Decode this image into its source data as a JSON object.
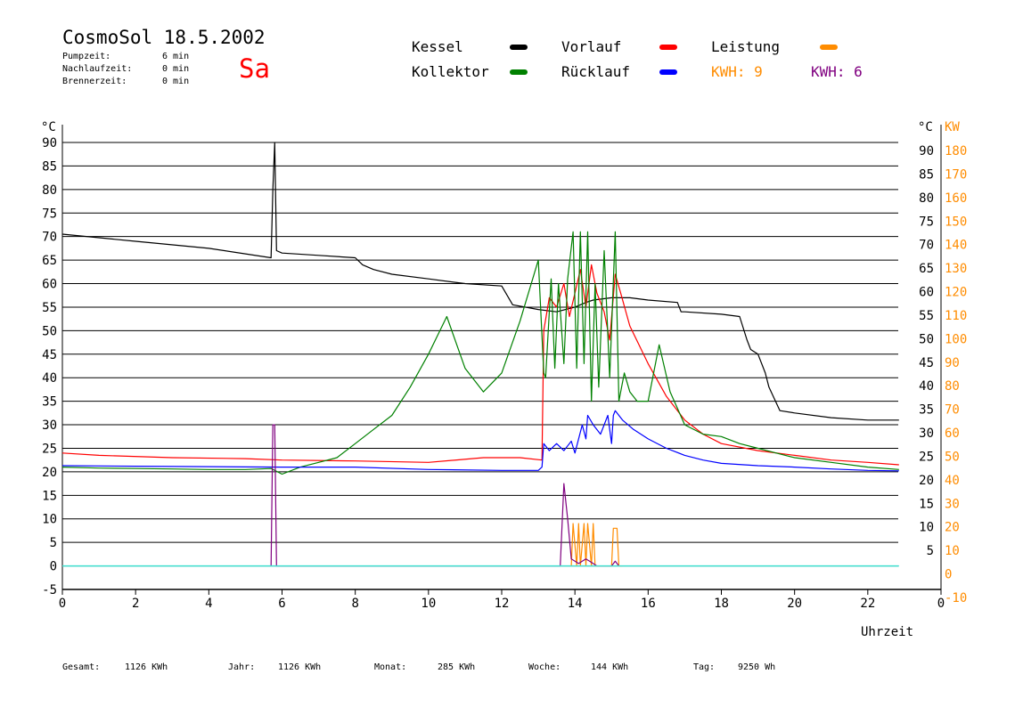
{
  "header": {
    "title": "CosmoSol 18.5.2002",
    "day": "Sa",
    "info": [
      {
        "label": "Pumpzeit:",
        "value": "6 min"
      },
      {
        "label": "Nachlaufzeit:",
        "value": "0 min"
      },
      {
        "label": "Brennerzeit:",
        "value": "0 min"
      }
    ]
  },
  "legend": {
    "kessel": "Kessel",
    "vorlauf": "Vorlauf",
    "leistung": "Leistung",
    "kollektor": "Kollektor",
    "ruecklauf": "Rücklauf",
    "kwh_orange": "KWH: 9",
    "kwh_purple": "KWH: 6"
  },
  "colors": {
    "kessel": "#000000",
    "vorlauf": "#ff0000",
    "leistung": "#ff8c00",
    "kollektor": "#008000",
    "ruecklauf": "#0000ff",
    "kwh_purple": "#800080",
    "zero_line": "#40e0d0"
  },
  "footer": {
    "gesamt_label": "Gesamt:",
    "gesamt_value": "1126 KWh",
    "jahr_label": "Jahr:",
    "jahr_value": "1126 KWh",
    "monat_label": "Monat:",
    "monat_value": "285 KWh",
    "woche_label": "Woche:",
    "woche_value": "144 KWh",
    "tag_label": "Tag:",
    "tag_value": "9250 Wh"
  },
  "chart_data": {
    "type": "line",
    "xlabel": "Uhrzeit",
    "ylabel_left": "°C",
    "ylabel_right_temp": "°C",
    "ylabel_right_power": "KW",
    "xlim": [
      0,
      24
    ],
    "ylim": [
      -5,
      90
    ],
    "x_ticks": [
      "0",
      "2",
      "4",
      "6",
      "8",
      "10",
      "12",
      "14",
      "16",
      "18",
      "20",
      "22",
      "0"
    ],
    "y_ticks_left": [
      "-5",
      "0",
      "5",
      "10",
      "15",
      "20",
      "25",
      "30",
      "35",
      "40",
      "45",
      "50",
      "55",
      "60",
      "65",
      "70",
      "75",
      "80",
      "85",
      "90"
    ],
    "y_ticks_right_temp": [
      "5",
      "10",
      "15",
      "20",
      "25",
      "30",
      "35",
      "40",
      "45",
      "50",
      "55",
      "60",
      "65",
      "70",
      "75",
      "80",
      "85",
      "90"
    ],
    "y_ticks_right_power": [
      "-10",
      "0",
      "10",
      "20",
      "30",
      "40",
      "50",
      "60",
      "70",
      "80",
      "90",
      "100",
      "110",
      "120",
      "130",
      "140",
      "150",
      "160",
      "170",
      "180"
    ],
    "series": [
      {
        "name": "Kessel",
        "color": "#000000",
        "x": [
          0,
          2,
          4,
          5.7,
          5.75,
          5.8,
          5.85,
          6,
          7,
          8,
          8.2,
          8.5,
          9,
          10,
          11,
          12,
          12.3,
          13,
          13.5,
          14,
          14.3,
          14.5,
          15,
          15.5,
          16,
          16.8,
          16.9,
          17,
          18,
          18.5,
          18.7,
          18.8,
          19,
          19.2,
          19.3,
          19.6,
          20,
          21,
          22,
          22.85
        ],
        "y": [
          70.5,
          69,
          67.5,
          65.5,
          80,
          90,
          67,
          66.5,
          66,
          65.5,
          64,
          63,
          62,
          61,
          60,
          59.5,
          55.5,
          54.5,
          54,
          55,
          56,
          56.5,
          57,
          57,
          56.5,
          56,
          54,
          54,
          53.5,
          53,
          48,
          46,
          45,
          41,
          38,
          33,
          32.5,
          31.5,
          31,
          31
        ]
      },
      {
        "name": "Vorlauf",
        "color": "#ff0000",
        "x": [
          0,
          1,
          3,
          5,
          6,
          8,
          10,
          11.5,
          12.5,
          13.1,
          13.15,
          13.3,
          13.5,
          13.7,
          13.85,
          14,
          14.15,
          14.3,
          14.45,
          14.6,
          14.8,
          14.95,
          15.1,
          15.25,
          15.5,
          16,
          16.5,
          17,
          17.5,
          18,
          19,
          20,
          21,
          22,
          22.85
        ],
        "y": [
          24,
          23.5,
          23,
          22.8,
          22.5,
          22.3,
          22,
          23,
          23,
          22.5,
          50,
          57,
          55,
          60,
          53,
          58,
          63,
          55,
          64,
          58,
          54,
          48,
          62,
          58,
          51,
          43,
          36,
          31,
          28,
          26,
          24.5,
          23.5,
          22.5,
          22,
          21.5
        ]
      },
      {
        "name": "Kollektor",
        "color": "#008000",
        "x": [
          0,
          1,
          2,
          3,
          4,
          5,
          5.7,
          6,
          6.5,
          7,
          7.5,
          8,
          8.5,
          9,
          9.5,
          10,
          10.5,
          11,
          11.5,
          12,
          12.5,
          13,
          13.15,
          13.2,
          13.35,
          13.45,
          13.55,
          13.7,
          13.8,
          13.95,
          14.05,
          14.15,
          14.25,
          14.35,
          14.45,
          14.55,
          14.65,
          14.8,
          14.95,
          15.1,
          15.2,
          15.35,
          15.5,
          15.7,
          16,
          16.3,
          16.6,
          17,
          17.5,
          18,
          18.5,
          19,
          19.5,
          20,
          21,
          22,
          22.85
        ],
        "y": [
          21,
          20.8,
          20.7,
          20.6,
          20.5,
          20.5,
          20.7,
          19.5,
          21,
          22,
          23,
          26,
          29,
          32,
          38,
          45,
          53,
          42,
          37,
          41,
          52,
          65,
          41,
          40,
          61,
          42,
          60,
          43,
          61,
          71,
          42,
          71,
          43,
          71,
          35,
          60,
          38,
          67,
          40,
          71,
          35,
          41,
          37,
          35,
          35,
          47,
          37,
          30,
          28,
          27.5,
          26,
          25,
          24,
          23,
          22,
          21,
          20.5
        ]
      },
      {
        "name": "Rücklauf",
        "color": "#0000ff",
        "x": [
          0,
          2,
          4,
          6,
          8,
          10,
          12,
          13,
          13.1,
          13.15,
          13.3,
          13.5,
          13.7,
          13.9,
          14,
          14.2,
          14.3,
          14.35,
          14.5,
          14.7,
          14.9,
          15,
          15.05,
          15.1,
          15.3,
          15.6,
          16,
          16.5,
          17,
          17.5,
          18,
          19,
          20,
          21,
          22,
          22.85
        ],
        "y": [
          21.3,
          21.2,
          21.1,
          21,
          21,
          20.5,
          20.3,
          20.3,
          21,
          26,
          24.5,
          26,
          24.5,
          26.5,
          24,
          30,
          27,
          32,
          30,
          28,
          32,
          26,
          32,
          33,
          31,
          29,
          27,
          25,
          23.5,
          22.5,
          21.8,
          21.3,
          21,
          20.6,
          20.3,
          20.2
        ]
      },
      {
        "name": "Leistung",
        "color": "#ff8c00",
        "axis": "power",
        "x": [
          13.9,
          13.95,
          14.05,
          14.1,
          14.15,
          14.25,
          14.3,
          14.35,
          14.45,
          14.5,
          14.55,
          15,
          15.05,
          15.15,
          15.2,
          15.3
        ],
        "y": [
          0,
          18,
          0,
          18,
          0,
          18,
          0,
          18,
          0,
          18,
          0,
          0,
          16,
          16,
          0,
          0
        ]
      },
      {
        "name": "KWH purple",
        "color": "#800080",
        "axis": "power",
        "x": [
          5.7,
          5.75,
          5.8,
          5.85,
          5.9,
          13.6,
          13.7,
          13.8,
          13.9,
          14,
          14.1,
          14.2,
          14.3,
          14.4,
          14.5,
          14.6,
          15,
          15.1,
          15.2
        ],
        "y": [
          0,
          60,
          60,
          0,
          0,
          0,
          35,
          20,
          3,
          2,
          1,
          2,
          3,
          2,
          1,
          0,
          0,
          2,
          0
        ]
      },
      {
        "name": "Zero line",
        "color": "#40e0d0",
        "x": [
          0,
          22.85
        ],
        "y": [
          0,
          0
        ]
      }
    ],
    "grid": true
  }
}
